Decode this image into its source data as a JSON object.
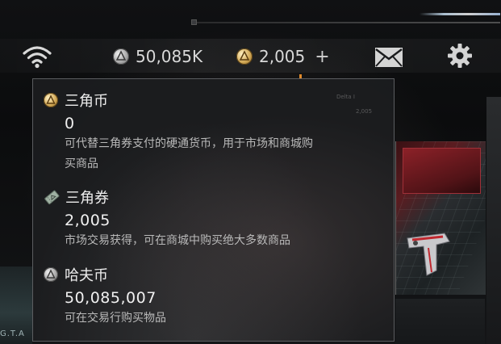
{
  "topbar": {
    "silver_amount": "50,085K",
    "gold_amount": "2,005",
    "plus_label": "+",
    "icons": {
      "wifi": "wifi-icon",
      "silver_coin": "silver-coin-icon",
      "gold_coin": "gold-coin-icon",
      "mail": "mail-icon",
      "settings": "gear-icon"
    }
  },
  "tooltip": {
    "entries": [
      {
        "icon": "gold-coin-icon",
        "title": "三角币",
        "amount": "0",
        "desc_line1": "可代替三角券支付的硬通货币，用于市场和商城购",
        "desc_line2": "买商品"
      },
      {
        "icon": "ticket-icon",
        "title": "三角券",
        "amount": "2,005",
        "desc_line1": "市场交易获得，可在商城中购买绝大多数商品"
      },
      {
        "icon": "silver-coin-icon",
        "title": "哈夫币",
        "amount": "50,085,007",
        "desc_line1": "可在交易行购买物品"
      }
    ]
  },
  "background": {
    "faint_text_1": "Delta I",
    "faint_text_2": "2,005",
    "corner_label": "G.T.A"
  },
  "colors": {
    "silver": "#a8a8a8",
    "gold": "#d2a855",
    "ticket": "#9fb0a2",
    "accent_orange": "#e08a2b"
  }
}
